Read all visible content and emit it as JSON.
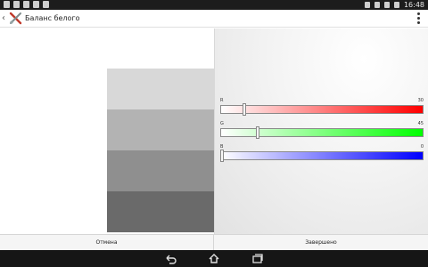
{
  "status_bar": {
    "time": "16:48",
    "notification_icons": [
      "settings-icon",
      "download-icon",
      "download-icon",
      "image-icon",
      "mail-icon"
    ]
  },
  "action_bar": {
    "title": "Баланс белого",
    "app_icon": "tools-icon",
    "back_icon": "chevron-left-icon",
    "menu_icon": "overflow-menu-icon"
  },
  "preview": {
    "swatch_colors": [
      "#d8d8d8",
      "#b3b3b3",
      "#8f8f8f",
      "#6a6a6a"
    ]
  },
  "sliders": [
    {
      "label": "R",
      "value": "30",
      "fraction": 0.11,
      "color": "#ff0000"
    },
    {
      "label": "G",
      "value": "45",
      "fraction": 0.18,
      "color": "#00ff00"
    },
    {
      "label": "B",
      "value": "0",
      "fraction": 0.0,
      "color": "#0000ff"
    }
  ],
  "footer": {
    "cancel_label": "Отмена",
    "done_label": "Завершено"
  },
  "nav_bar": {
    "back_icon": "nav-back-icon",
    "home_icon": "nav-home-icon",
    "recents_icon": "nav-recents-icon"
  }
}
